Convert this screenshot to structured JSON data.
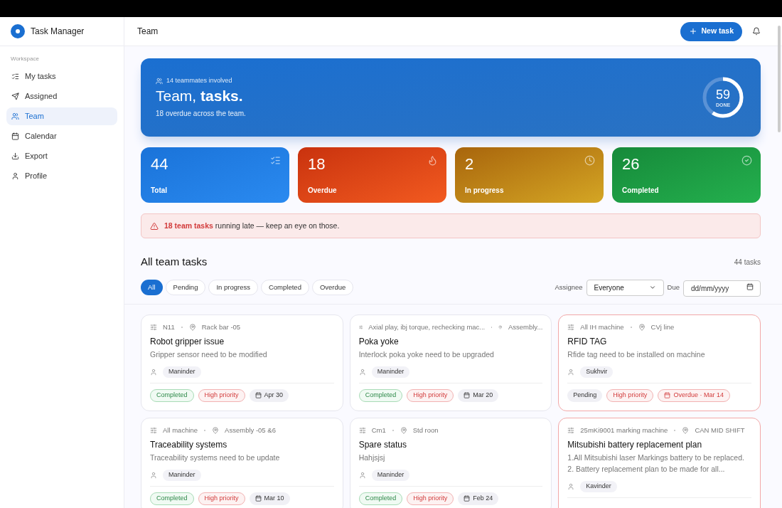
{
  "app": {
    "name": "Task Manager"
  },
  "sidebar": {
    "section": "Workspace",
    "items": [
      {
        "label": "My tasks",
        "selected": false
      },
      {
        "label": "Assigned",
        "selected": false
      },
      {
        "label": "Team",
        "selected": true
      },
      {
        "label": "Calendar",
        "selected": false
      },
      {
        "label": "Export",
        "selected": false
      },
      {
        "label": "Profile",
        "selected": false
      }
    ]
  },
  "header": {
    "title": "Team",
    "new_button": "New task"
  },
  "hero": {
    "teammates": "14 teammates involved",
    "title": "Team, **tasks.**",
    "subtitle": "18 overdue across the team.",
    "ring": {
      "value": "59",
      "label": "DONE",
      "level": 0.59
    }
  },
  "stats": [
    {
      "value": "44",
      "label": "Total",
      "kind": "total"
    },
    {
      "value": "18",
      "label": "Overdue",
      "kind": "overdue"
    },
    {
      "value": "2",
      "label": "In progress",
      "kind": "progress"
    },
    {
      "value": "26",
      "label": "Completed",
      "kind": "completed"
    }
  ],
  "alert": {
    "text": "**18 team tasks** running late — keep an eye on those."
  },
  "list": {
    "title": "All team tasks",
    "count": "44 tasks",
    "filters": [
      {
        "label": "All",
        "selected": true
      },
      {
        "label": "Pending",
        "selected": false
      },
      {
        "label": "In progress",
        "selected": false
      },
      {
        "label": "Completed",
        "selected": false
      },
      {
        "label": "Overdue",
        "selected": false
      }
    ],
    "assignee": {
      "label": "Assignee",
      "value": "Everyone"
    },
    "due": {
      "label": "Due",
      "placeholder": "dd/mm/yyyy"
    }
  },
  "tasks": [
    {
      "machine": "N11",
      "location": "Rack bar -05",
      "title": "Robot gripper issue",
      "description": "Gripper sensor need to be modified",
      "assignee": "Maninder",
      "status": "Completed",
      "done": true,
      "priority": "High priority",
      "due": "Apr 30",
      "overdue": false
    },
    {
      "machine": "Axial play, ibj torque, rechecking mac...",
      "location": "Assembly...",
      "title": "Poka yoke",
      "description": "Interlock poka yoke need to be upgraded",
      "assignee": "Maninder",
      "status": "Completed",
      "done": true,
      "priority": "High priority",
      "due": "Mar 20",
      "overdue": false
    },
    {
      "machine": "All IH machine",
      "location": "CVj line",
      "title": "RFID TAG",
      "description": "Rfide tag need to be installed on machine",
      "assignee": "Sukhvir",
      "status": "Pending",
      "done": false,
      "priority": "High priority",
      "due": "Overdue · Mar 14",
      "overdue": true
    },
    {
      "machine": "All machine",
      "location": "Assembly -05 &6",
      "title": "Traceability systems",
      "description": "Traceability systems need to be update",
      "assignee": "Maninder",
      "status": "Completed",
      "done": true,
      "priority": "High priority",
      "due": "Mar 10",
      "overdue": false
    },
    {
      "machine": "Cm1",
      "location": "Std roon",
      "title": "Spare status",
      "description": "Hahjsjsj",
      "assignee": "Maninder",
      "status": "Completed",
      "done": true,
      "priority": "High priority",
      "due": "Feb 24",
      "overdue": false
    },
    {
      "machine": "25mKi9001 marking machine",
      "location": "CAN MID SHIFT",
      "title": "Mitsubishi battery replacement plan",
      "description": "1.All Mitsubishi laser Markings battery to be replaced. 2. Battery replacement plan to be made for all...",
      "assignee": "Kavinder",
      "overdue": true
    }
  ]
}
